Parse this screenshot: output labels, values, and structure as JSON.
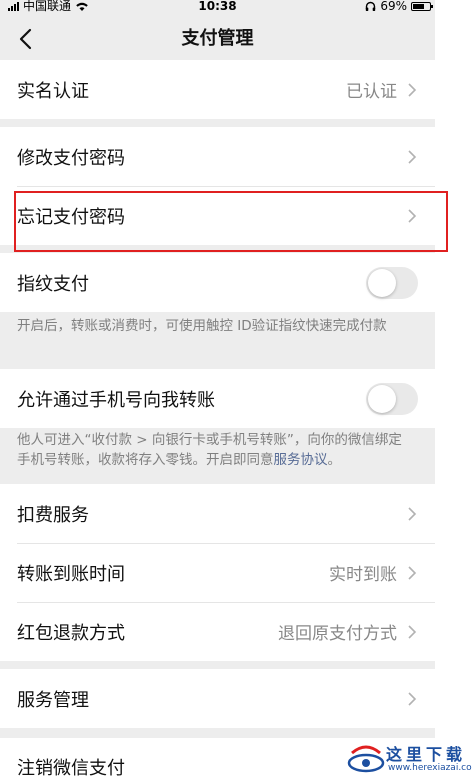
{
  "status_bar": {
    "carrier": "中国联通",
    "time": "10:38",
    "battery": "69%",
    "battery_level": 0.69
  },
  "nav": {
    "title": "支付管理",
    "back_icon": "chevron-left-icon"
  },
  "section_realname": {
    "label": "实名认证",
    "value": "已认证"
  },
  "section_password": {
    "change_label": "修改支付密码",
    "forgot_label": "忘记支付密码"
  },
  "fingerprint": {
    "label": "指纹支付",
    "enabled": false,
    "desc": "开启后，转账或消费时，可使用触控 ID验证指纹快速完成付款"
  },
  "phone_transfer": {
    "label": "允许通过手机号向我转账",
    "enabled": false,
    "desc": "他人可进入“收付款 > 向银行卡或手机号转账”，向你的微信绑定手机号转账，收款将存入零钱。开启即同意",
    "link": "服务协议",
    "desc_end": "。"
  },
  "section_services": {
    "deduction_label": "扣费服务",
    "transfer_time_label": "转账到账时间",
    "transfer_time_value": "实时到账",
    "redpacket_label": "红包退款方式",
    "redpacket_value": "退回原支付方式"
  },
  "section_manage": {
    "manage_label": "服务管理",
    "cancel_label": "注销微信支付"
  },
  "watermark": {
    "title": "这里下载",
    "url": "www.herexiazai.com"
  },
  "colors": {
    "background": "#ededed",
    "highlight": "#e02020",
    "link": "#576b95"
  }
}
